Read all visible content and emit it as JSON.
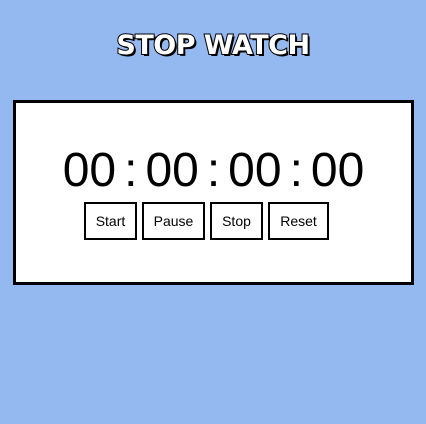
{
  "app": {
    "title": "STOP WATCH"
  },
  "display": {
    "hours": "00",
    "minutes": "00",
    "seconds": "00",
    "milliseconds": "00",
    "separator": ":"
  },
  "controls": {
    "start_label": "Start",
    "pause_label": "Pause",
    "stop_label": "Stop",
    "reset_label": "Reset"
  },
  "colors": {
    "background": "#94b8f0",
    "panel": "#ffffff",
    "border": "#000000"
  }
}
